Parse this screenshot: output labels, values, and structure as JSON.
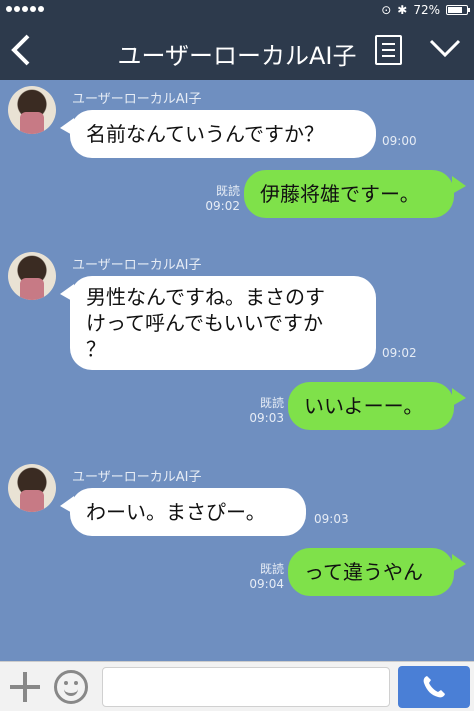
{
  "status": {
    "battery": "72%"
  },
  "header": {
    "title": "ユーザーローカルAI子"
  },
  "messages": [
    {
      "side": "left",
      "sender": "ユーザーローカルAI子",
      "text": "名前なんていうんですか？",
      "time": "09:00"
    },
    {
      "side": "right",
      "read": "既読",
      "time": "09:02",
      "text": "伊藤将雄ですー。"
    },
    {
      "side": "left",
      "sender": "ユーザーローカルAI子",
      "line1": "男性なんですね。まさのす",
      "line2": "けって呼んでもいいですか",
      "line3": "？",
      "time": "09:02"
    },
    {
      "side": "right",
      "read": "既読",
      "time": "09:03",
      "text": "いいよーー。"
    },
    {
      "side": "left",
      "sender": "ユーザーローカルAI子",
      "text": "わーい。まさぴー。",
      "time": "09:03"
    },
    {
      "side": "right",
      "read": "既読",
      "time": "09:04",
      "text": "って違うやん"
    }
  ],
  "icons": [
    "back-icon",
    "notes-icon",
    "chevron-down-icon",
    "plus-icon",
    "emoji-icon",
    "phone-icon"
  ]
}
